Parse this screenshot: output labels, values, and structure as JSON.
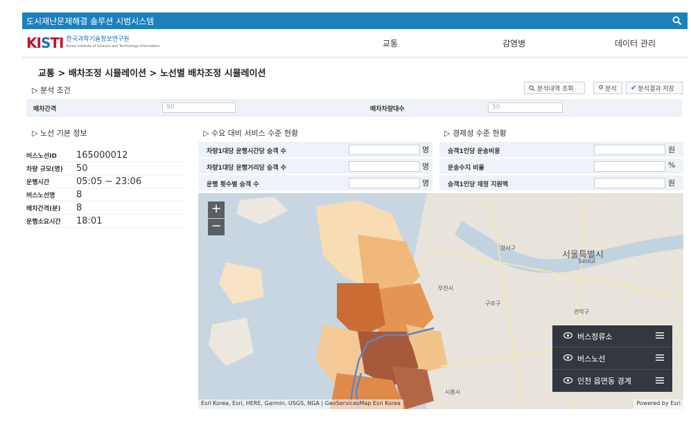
{
  "window": {
    "title": "도시재난문제해결 솔루션 시범시스템"
  },
  "logo": {
    "mark": "KISTI",
    "org_name": "한국과학기술정보연구원",
    "org_sub": "Korea Institute of Science and Technology Information"
  },
  "nav": {
    "items": [
      "교통",
      "감염병",
      "데이터 관리"
    ]
  },
  "breadcrumb": "교통 > 배차조정 시뮬레이션 > 노선별 배차조정 시뮬레이션",
  "analysis_conditions": {
    "section_label": "▷ 분석 조건",
    "interval_label": "배차간격",
    "interval_value": "90",
    "vehicles_label": "배차차량대수",
    "vehicles_value": "50"
  },
  "toolbar": {
    "history_label": "분석내역 조회",
    "analyze_label": "분석",
    "save_label": "분석결과 저장"
  },
  "route_info": {
    "section_label": "▷ 노선 기본 정보",
    "rows": [
      {
        "key": "버스노선ID",
        "value": "165000012"
      },
      {
        "key": "차량 규모(명)",
        "value": "50"
      },
      {
        "key": "운행시간",
        "value": "05:05 ~ 23:06"
      },
      {
        "key": "버스노선명",
        "value": "8"
      },
      {
        "key": "배차간격(분)",
        "value": "8"
      },
      {
        "key": "운행소요시간",
        "value": "18:01"
      }
    ]
  },
  "service_level": {
    "section_label": "▷ 수요 대비 서비스 수준 현황",
    "rows": [
      {
        "label": "차량1대당 운행시간당 승객 수",
        "unit": "명"
      },
      {
        "label": "차량1대당 운행거리당 승객 수",
        "unit": "명"
      },
      {
        "label": "운행 횟수별 승객 수",
        "unit": "명"
      }
    ]
  },
  "economics": {
    "section_label": "▷ 경제성 수준 현황",
    "rows": [
      {
        "label": "승객1인당 운송비용",
        "unit": "원"
      },
      {
        "label": "운송수지 비율",
        "unit": "%"
      },
      {
        "label": "승객1인당 재정 지원액",
        "unit": "원"
      }
    ]
  },
  "map": {
    "zoom_in": "+",
    "zoom_out": "−",
    "attribution": "Esri Korea, Esri, HERE, Garmin, USGS, NGA | GeoServicesMap Esri Korea",
    "powered_by": "Powered by Esri",
    "place_labels": {
      "seoul": "서울특별시",
      "seoul_en": "Seoul",
      "gangseo": "강서구",
      "bucheon": "부천시",
      "guro": "구로구",
      "gwanak": "관악구",
      "siheung": "시흥시"
    }
  },
  "layers": {
    "items": [
      "버스정류소",
      "버스노선",
      "인천 읍면동 경계"
    ]
  },
  "colors": {
    "header": "#1c80bd",
    "panel_bg": "#edf3f9",
    "layer_panel": "#33383e"
  }
}
